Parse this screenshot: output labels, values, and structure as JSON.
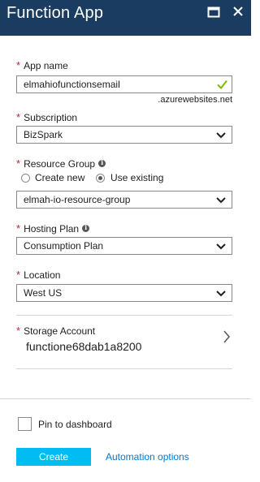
{
  "header": {
    "title": "Function App"
  },
  "app_name": {
    "label": "App name",
    "value": "elmahiofunctionsemail",
    "suffix": ".azurewebsites.net"
  },
  "subscription": {
    "label": "Subscription",
    "value": "BizSpark"
  },
  "resource_group": {
    "label": "Resource Group",
    "options": [
      {
        "label": "Create new",
        "selected": false
      },
      {
        "label": "Use existing",
        "selected": true
      }
    ],
    "value": "elmah-io-resource-group"
  },
  "hosting_plan": {
    "label": "Hosting Plan",
    "value": "Consumption Plan"
  },
  "location": {
    "label": "Location",
    "value": "West US"
  },
  "storage_account": {
    "label": "Storage Account",
    "value": "functione68dab1a8200"
  },
  "footer": {
    "pin_label": "Pin to dashboard",
    "pin_checked": false,
    "create_label": "Create",
    "automation_label": "Automation options"
  },
  "colors": {
    "header_bg": "#1b3c61",
    "required_star": "#c0262d",
    "create_button": "#00bcf2",
    "link": "#0078d7",
    "valid_check": "#7fba00"
  }
}
